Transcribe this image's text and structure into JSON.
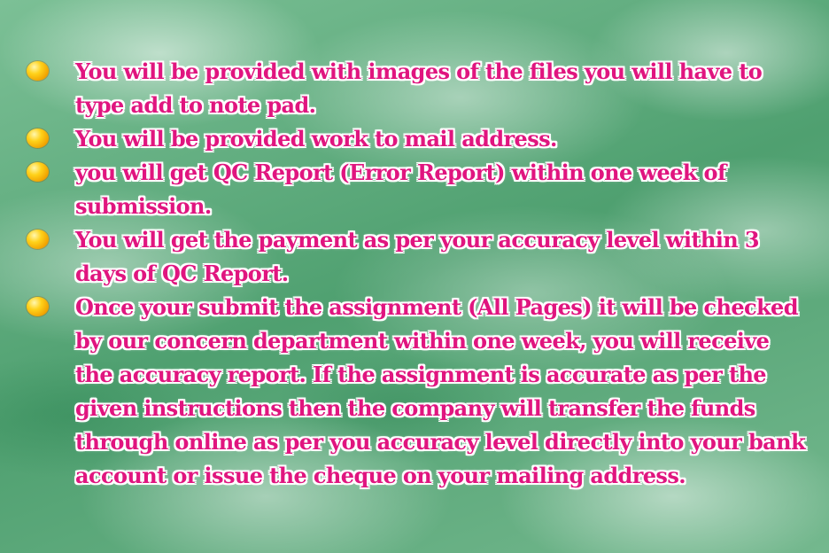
{
  "bullets": [
    {
      "text": "You will be provided with images of the files you will have to type add to note pad."
    },
    {
      "text": "You will be provided work to mail address."
    },
    {
      "text": "you will get QC Report (Error Report) within one week of submission."
    },
    {
      "text": "You will get the payment as per your accuracy level within 3 days of QC Report."
    },
    {
      "text": "Once your submit the assignment (All Pages) it will be checked by our concern department within one week, you will receive the accuracy report. If the assignment is accurate as per the given instructions then the company will transfer the funds through online as per you accuracy level directly into your bank account or issue the cheque on your mailing address."
    }
  ],
  "icons": {
    "bullet": "orange-circle-icon"
  },
  "colors": {
    "text": "#e0157f",
    "text_outline": "#ffffff",
    "bullet": "#f5b400",
    "background": "#5fae7e"
  }
}
